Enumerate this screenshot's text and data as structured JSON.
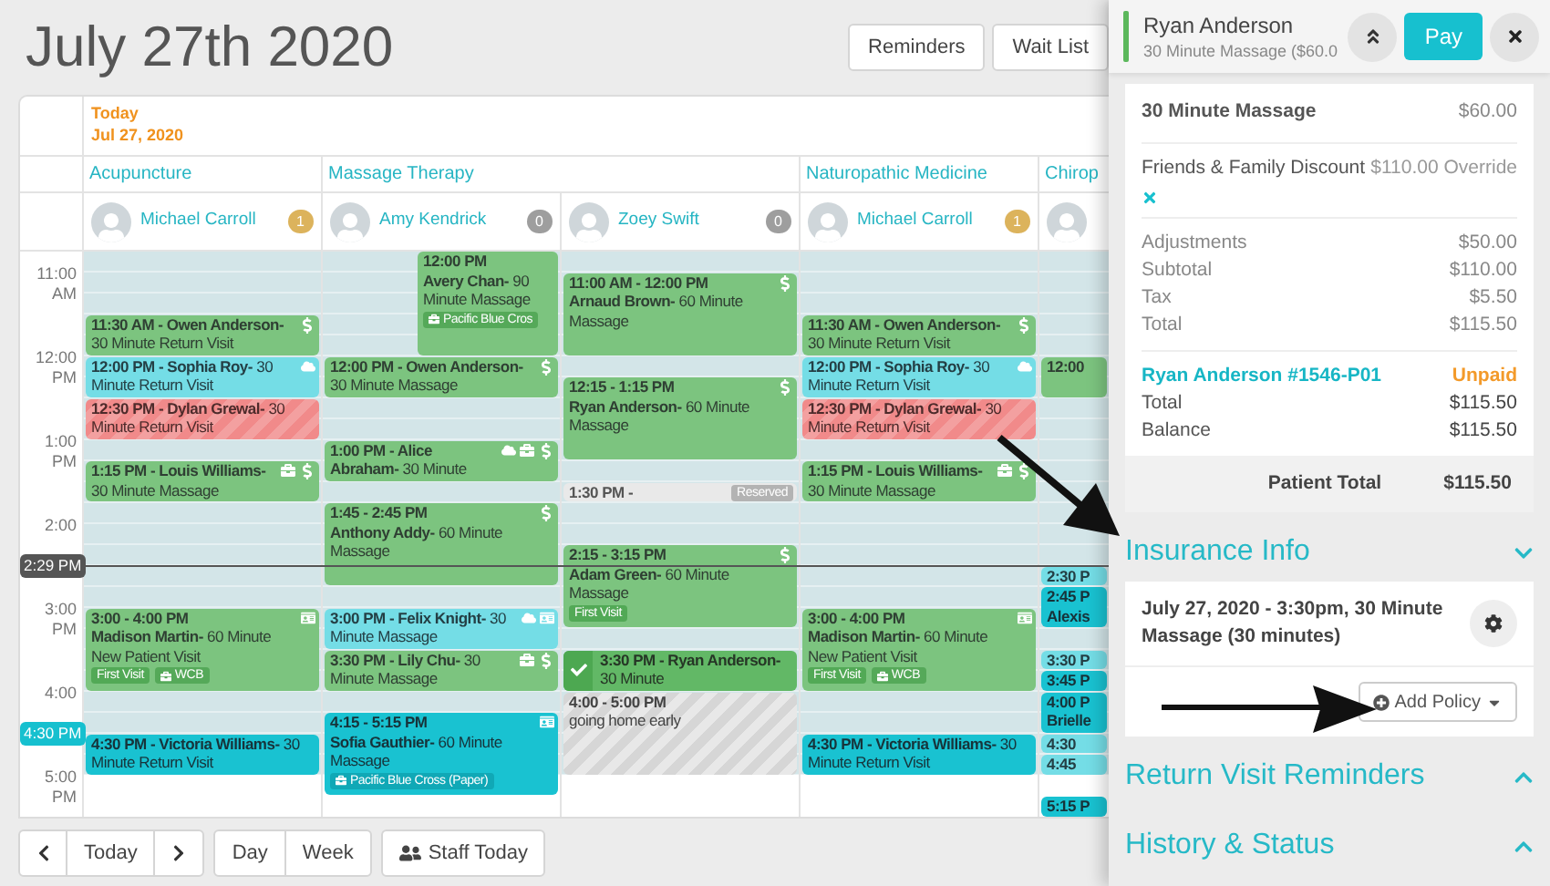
{
  "header": {
    "title": "July 27th 2020",
    "buttons": [
      "Reminders",
      "Wait List"
    ]
  },
  "calendar": {
    "today_label": "Today",
    "date": "Jul 27, 2020",
    "hours": [
      {
        "hour": "11:00",
        "period": "AM"
      },
      {
        "hour": "12:00",
        "period": "PM"
      },
      {
        "hour": "1:00",
        "period": "PM"
      },
      {
        "hour": "2:00",
        "marker": {
          "kind": "now",
          "label": "2:29 PM"
        }
      },
      {
        "hour": "3:00",
        "period": "PM"
      },
      {
        "hour": "4:00",
        "marker": {
          "kind": "hover",
          "label": "4:30 PM"
        }
      },
      {
        "hour": "5:00",
        "period": "PM"
      }
    ],
    "disciplines": [
      {
        "name": "Acupuncture",
        "staff": [
          {
            "name": "Michael Carroll",
            "count": "1",
            "color": "#dcb35c",
            "slots": [
              {
                "kind": "free"
              },
              {
                "kind": "free"
              },
              {
                "kind": "free"
              },
              {
                "kind": "booked",
                "text": "**11:30 AM - Owen Anderson-** 30 Minute Return Visit",
                "paid": true
              },
              {
                "kind": "cont"
              },
              {
                "kind": "online",
                "text": "**12:00 PM - Sophia Roy-** 30 Minute Return Visit",
                "online": true
              },
              {
                "kind": "cont"
              },
              {
                "kind": "missed",
                "text": "**12:30 PM - Dylan Grewal-** 30 Minute Return Visit"
              },
              {
                "kind": "cont"
              },
              {
                "kind": "free"
              },
              {
                "kind": "booked",
                "text": "**1:15 PM - Louis Williams-** 30 Minute Massage",
                "insured": true,
                "paid": true
              },
              {
                "kind": "cont"
              },
              {
                "kind": "free"
              },
              {
                "kind": "free"
              },
              {
                "kind": "free"
              },
              {
                "kind": "free"
              },
              {
                "kind": "free"
              },
              {
                "kind": "booked",
                "title": "3:00 - 4:00 PM",
                "text": "**Madison Martin-** 60 Minute New Patient Visit",
                "tag": "First Visit",
                "insurance": "WCB",
                "card_on_file": true
              },
              {
                "kind": "cont"
              },
              {
                "kind": "cont"
              },
              {
                "kind": "cont"
              },
              {
                "kind": "free"
              },
              {
                "kind": "free"
              },
              {
                "kind": "upcoming",
                "text": "**4:30 PM - Victoria Williams-** 30 Minute Return Visit"
              },
              {
                "kind": "cont"
              }
            ]
          }
        ]
      },
      {
        "name": "Massage Therapy",
        "staff": [
          {
            "name": "Amy Kendrick",
            "count": "0",
            "color": "#9e9e9e",
            "slots": [
              {
                "kind": "booked",
                "overlap": true,
                "title": "12:00 PM",
                "text": "**Avery Chan-** 90 Minute Massage",
                "insurance": "Pacific Blue Cros"
              },
              {
                "kind": "cont"
              },
              {
                "kind": "cont"
              },
              {
                "kind": "cont"
              },
              {
                "kind": "cont"
              },
              {
                "kind": "booked",
                "text": "**12:00 PM - Owen Anderson-** 30 Minute Massage",
                "paid": true
              },
              {
                "kind": "cont"
              },
              {
                "kind": "free"
              },
              {
                "kind": "free"
              },
              {
                "kind": "booked",
                "text": "**1:00 PM - Alice Abraham-** 30 Minute",
                "online": true,
                "insured": true,
                "paid": true
              },
              {
                "kind": "cont"
              },
              {
                "kind": "free"
              },
              {
                "kind": "booked",
                "title": "1:45 - 2:45 PM",
                "text": "**Anthony Addy-** 60 Minute Massage",
                "paid": true
              },
              {
                "kind": "cont"
              },
              {
                "kind": "cont"
              },
              {
                "kind": "cont"
              },
              {
                "kind": "free"
              },
              {
                "kind": "online",
                "text": "**3:00 PM - Felix Knight-** 30 Minute Massage",
                "online": true,
                "card_on_file": true
              },
              {
                "kind": "cont"
              },
              {
                "kind": "booked",
                "text": "**3:30 PM - Lily Chu-** 30 Minute Massage",
                "insured": true,
                "paid": true
              },
              {
                "kind": "cont"
              },
              {
                "kind": "free"
              },
              {
                "kind": "upcoming",
                "title": "4:15 - 5:15 PM",
                "text": "**Sofia Gauthier-** 60 Minute Massage",
                "insurance": "Pacific Blue Cross (Paper)",
                "card_on_file": true
              },
              {
                "kind": "cont"
              },
              {
                "kind": "cont"
              },
              {
                "kind": "cont"
              }
            ]
          },
          {
            "name": "Zoey Swift",
            "count": "0",
            "color": "#9e9e9e",
            "slots": [
              {
                "kind": "free"
              },
              {
                "kind": "booked",
                "title": "11:00 AM - 12:00 PM",
                "text": "**Arnaud Brown-** 60 Minute Massage",
                "paid": true
              },
              {
                "kind": "cont"
              },
              {
                "kind": "cont"
              },
              {
                "kind": "cont"
              },
              {
                "kind": "free"
              },
              {
                "kind": "booked",
                "title": "12:15 - 1:15 PM",
                "text": "**Ryan Anderson-** 60 Minute Massage",
                "paid": true
              },
              {
                "kind": "cont"
              },
              {
                "kind": "cont"
              },
              {
                "kind": "cont"
              },
              {
                "kind": "free"
              },
              {
                "kind": "reserved",
                "title": "1:30 PM -",
                "tag": "Reserved"
              },
              {
                "kind": "free"
              },
              {
                "kind": "free"
              },
              {
                "kind": "booked",
                "title": "2:15 - 3:15 PM",
                "text": "**Adam Green-** 60 Minute Massage",
                "tag": "First Visit",
                "paid": true
              },
              {
                "kind": "cont"
              },
              {
                "kind": "cont"
              },
              {
                "kind": "cont"
              },
              {
                "kind": "free"
              },
              {
                "kind": "arrived",
                "checked": true,
                "text": "**3:30 PM - Ryan Anderson-** 30 Minute"
              },
              {
                "kind": "cont"
              },
              {
                "kind": "blocked",
                "title": "4:00 - 5:00 PM",
                "text": "going home early"
              },
              {
                "kind": "cont"
              },
              {
                "kind": "cont"
              },
              {
                "kind": "cont"
              }
            ]
          }
        ]
      },
      {
        "name": "Naturopathic Medicine",
        "staff": [
          {
            "name": "Michael Carroll",
            "count": "1",
            "color": "#dcb35c",
            "slots": [
              {
                "kind": "free"
              },
              {
                "kind": "free"
              },
              {
                "kind": "free"
              },
              {
                "kind": "booked",
                "text": "**11:30 AM - Owen Anderson-** 30 Minute Return Visit",
                "paid": true
              },
              {
                "kind": "cont"
              },
              {
                "kind": "online",
                "text": "**12:00 PM - Sophia Roy-** 30 Minute Return Visit",
                "online": true
              },
              {
                "kind": "cont"
              },
              {
                "kind": "missed",
                "text": "**12:30 PM - Dylan Grewal-** 30 Minute Return Visit"
              },
              {
                "kind": "cont"
              },
              {
                "kind": "free"
              },
              {
                "kind": "booked",
                "text": "**1:15 PM - Louis Williams-** 30 Minute Massage",
                "insured": true,
                "paid": true
              },
              {
                "kind": "cont"
              },
              {
                "kind": "free"
              },
              {
                "kind": "free"
              },
              {
                "kind": "free"
              },
              {
                "kind": "free"
              },
              {
                "kind": "free"
              },
              {
                "kind": "booked",
                "title": "3:00 - 4:00 PM",
                "text": "**Madison Martin-** 60 Minute New Patient Visit",
                "tag": "First Visit",
                "insurance": "WCB",
                "card_on_file": true
              },
              {
                "kind": "cont"
              },
              {
                "kind": "cont"
              },
              {
                "kind": "cont"
              },
              {
                "kind": "free"
              },
              {
                "kind": "free"
              },
              {
                "kind": "upcoming",
                "text": "**4:30 PM - Victoria Williams-** 30 Minute Return Visit"
              },
              {
                "kind": "cont"
              }
            ]
          }
        ]
      },
      {
        "name": "Chirop",
        "staff": [
          {
            "slots": [
              {
                "kind": "free"
              },
              {
                "kind": "free"
              },
              {
                "kind": "free"
              },
              {
                "kind": "free"
              },
              {
                "kind": "free"
              },
              {
                "kind": "booked",
                "title": "12:00"
              },
              {
                "kind": "cont"
              },
              {
                "kind": "free"
              },
              {
                "kind": "free"
              },
              {
                "kind": "free"
              },
              {
                "kind": "free"
              },
              {
                "kind": "free"
              },
              {
                "kind": "free"
              },
              {
                "kind": "free"
              },
              {
                "kind": "free"
              },
              {
                "kind": "online",
                "title": "2:30 P"
              },
              {
                "kind": "upcoming",
                "title": "2:45 P Alexis"
              },
              {
                "kind": "cont"
              },
              {
                "kind": "free"
              },
              {
                "kind": "online",
                "title": "3:30 P"
              },
              {
                "kind": "upcoming",
                "title": "3:45 P"
              },
              {
                "kind": "upcoming",
                "title": "4:00 P Brielle"
              },
              {
                "kind": "cont"
              },
              {
                "kind": "online",
                "title": "4:30"
              },
              {
                "kind": "online",
                "title": "4:45"
              },
              {
                "kind": "free"
              },
              {
                "kind": "upcoming",
                "title": "5:15 P"
              }
            ]
          }
        ]
      }
    ]
  },
  "toolbar": {
    "today": "Today",
    "views": [
      "Day",
      "Week"
    ],
    "staff_button": "Staff Today"
  },
  "panel": {
    "title": "Ryan Anderson",
    "subtitle": "30 Minute Massage ($60.0",
    "pay": "Pay",
    "bill": {
      "item": {
        "label": "30 Minute Massage",
        "amount": "$60.00"
      },
      "discount": {
        "label": "Friends & Family Discount",
        "amount": "$110.00 Override"
      },
      "summary": [
        {
          "label": "Adjustments",
          "amount": "$50.00"
        },
        {
          "label": "Subtotal",
          "amount": "$110.00"
        },
        {
          "label": "Tax",
          "amount": "$5.50"
        },
        {
          "label": "Total",
          "amount": "$115.50"
        }
      ],
      "payer": {
        "name": "Ryan Anderson #1546-P01",
        "status": "Unpaid"
      },
      "payer_rows": [
        {
          "label": "Total",
          "amount": "$115.50"
        },
        {
          "label": "Balance",
          "amount": "$115.50"
        }
      ],
      "footer": {
        "label": "Patient Total",
        "amount": "$115.50"
      }
    },
    "sections": [
      {
        "title": "Insurance Info",
        "expanded": true,
        "entry": "July 27, 2020 - 3:30pm, 30 Minute Massage (30 minutes)",
        "button": "Add Policy"
      },
      {
        "title": "Return Visit Reminders",
        "expanded": false
      },
      {
        "title": "History & Status",
        "expanded": false
      }
    ]
  }
}
